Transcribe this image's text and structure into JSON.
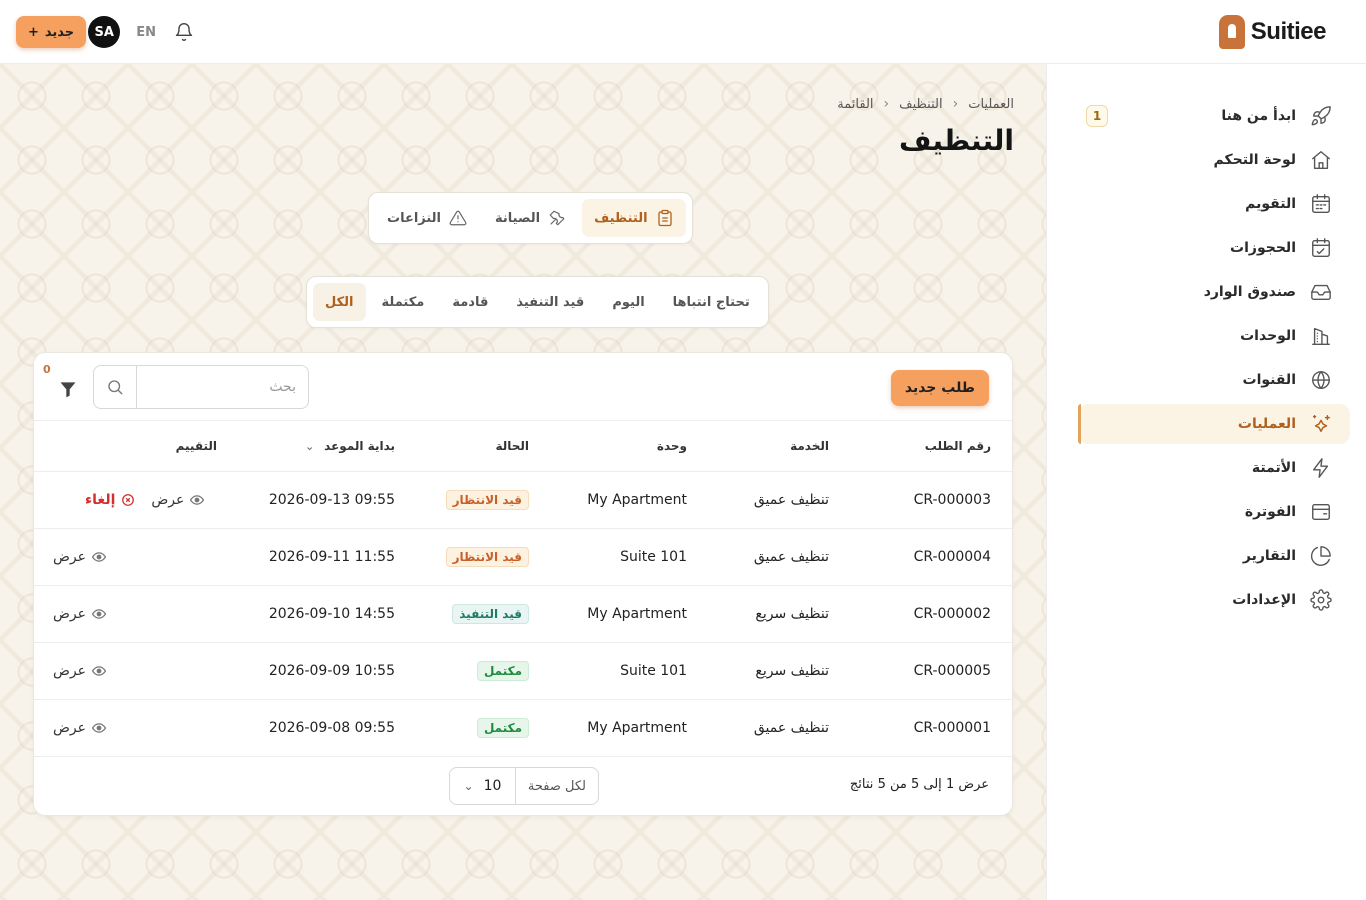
{
  "topbar": {
    "brand": "Suitiee",
    "new_label": "جديد",
    "new_icon": "plus-icon",
    "avatar": "SA",
    "lang": "EN",
    "bell_icon": "bell-icon"
  },
  "sidebar": {
    "items": [
      {
        "label": "ابدأ من هنا",
        "icon": "rocket-icon",
        "badge": "1"
      },
      {
        "label": "لوحة التحكم",
        "icon": "home-icon"
      },
      {
        "label": "التقويم",
        "icon": "calendar-icon"
      },
      {
        "label": "الحجوزات",
        "icon": "booking-calendar-icon"
      },
      {
        "label": "صندوق الوارد",
        "icon": "inbox-icon"
      },
      {
        "label": "الوحدات",
        "icon": "building-icon"
      },
      {
        "label": "القنوات",
        "icon": "globe-icon"
      },
      {
        "label": "العمليات",
        "icon": "sparkles-icon",
        "active": true
      },
      {
        "label": "الأتمتة",
        "icon": "lightning-icon"
      },
      {
        "label": "الفوترة",
        "icon": "wallet-icon"
      },
      {
        "label": "التقارير",
        "icon": "pie-chart-icon"
      },
      {
        "label": "الإعدادات",
        "icon": "gear-icon"
      }
    ]
  },
  "breadcrumb": [
    "العمليات",
    "التنظيف",
    "القائمة"
  ],
  "page_title": "التنظيف",
  "main_tabs": [
    {
      "label": "التنظيف",
      "icon": "clipboard-icon",
      "active": true
    },
    {
      "label": "الصيانة",
      "icon": "tools-icon"
    },
    {
      "label": "النزاعات",
      "icon": "warning-icon"
    }
  ],
  "filter_tabs": [
    {
      "label": "تحتاج انتباها"
    },
    {
      "label": "اليوم"
    },
    {
      "label": "قيد التنفيذ"
    },
    {
      "label": "قادمة"
    },
    {
      "label": "مكتملة"
    },
    {
      "label": "الكل",
      "active": true
    }
  ],
  "toolbar": {
    "new_request": "طلب جديد",
    "search_placeholder": "بحث",
    "filter_count": "0"
  },
  "table": {
    "columns": [
      "رقم الطلب",
      "الخدمة",
      "وحدة",
      "الحالة",
      "بداية الموعد",
      "التقييم"
    ],
    "rows": [
      {
        "id": "CR-000003",
        "service": "تنظيف عميق",
        "unit": "My Apartment",
        "status": "قيد الانتظار",
        "status_type": "pending",
        "start": "2026-09-13 09:55",
        "view": "عرض",
        "cancel": "إلغاء"
      },
      {
        "id": "CR-000004",
        "service": "تنظيف عميق",
        "unit": "Suite 101",
        "status": "قيد الانتظار",
        "status_type": "pending",
        "start": "2026-09-11 11:55",
        "view": "عرض"
      },
      {
        "id": "CR-000002",
        "service": "تنظيف سريع",
        "unit": "My Apartment",
        "status": "قيد التنفيذ",
        "status_type": "progress",
        "start": "2026-09-10 14:55",
        "view": "عرض"
      },
      {
        "id": "CR-000005",
        "service": "تنظيف سريع",
        "unit": "Suite 101",
        "status": "مكتمل",
        "status_type": "done",
        "start": "2026-09-09 10:55",
        "view": "عرض"
      },
      {
        "id": "CR-000001",
        "service": "تنظيف عميق",
        "unit": "My Apartment",
        "status": "مكتمل",
        "status_type": "done",
        "start": "2026-09-08 09:55",
        "view": "عرض"
      }
    ]
  },
  "footer": {
    "results": "عرض 1 إلى 5 من 5 نتائج",
    "per_page_label": "لكل صفحة",
    "per_page_value": "10"
  },
  "colors": {
    "accent": "#f5a05f",
    "accent_text": "#b05f1c",
    "background": "#f7f3ea"
  }
}
